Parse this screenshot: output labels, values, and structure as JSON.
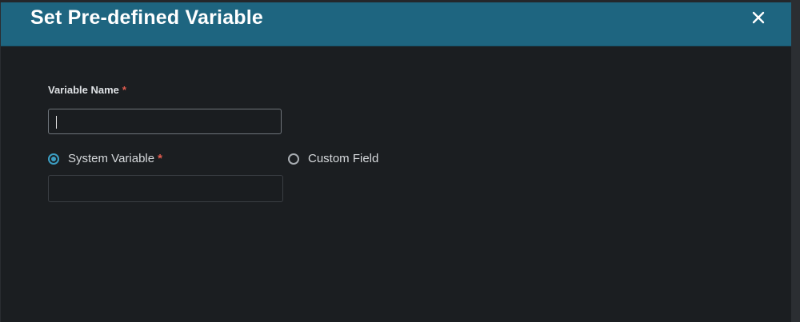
{
  "dialog": {
    "title": "Set Pre-defined Variable",
    "close_icon": "close-icon"
  },
  "form": {
    "variable_name_label": "Variable Name",
    "required_mark": "*",
    "variable_name_value": "",
    "options": [
      {
        "label": "System Variable",
        "selected": true,
        "required": true
      },
      {
        "label": "Custom Field",
        "selected": false,
        "required": false
      }
    ],
    "system_variable_value": ""
  },
  "colors": {
    "header": "#1e6580",
    "background": "#1b1e21",
    "accent": "#3c9fc4",
    "required": "#e35c4f"
  }
}
